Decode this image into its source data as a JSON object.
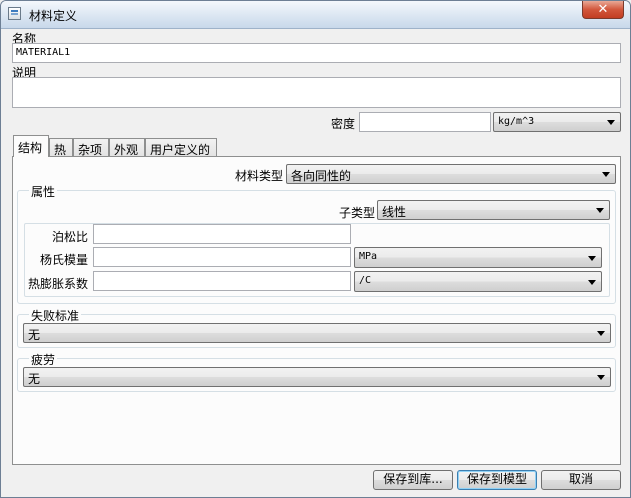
{
  "window": {
    "title": "材料定义",
    "close_glyph": "✕",
    "icon": "app-form-icon"
  },
  "name_label": "名称",
  "name_value": "MATERIAL1",
  "description_label": "说明",
  "description_value": "",
  "density": {
    "label": "密度",
    "value": "",
    "unit": "kg/m^3"
  },
  "tabs": [
    {
      "label": "结构",
      "active": true
    },
    {
      "label": "热"
    },
    {
      "label": "杂项"
    },
    {
      "label": "外观"
    },
    {
      "label": "用户定义的"
    }
  ],
  "material_type": {
    "label": "材料类型",
    "value": "各向同性的"
  },
  "properties": {
    "title": "属性",
    "subtype_label": "子类型",
    "subtype_value": "线性",
    "rows": [
      {
        "label": "泊松比",
        "value": ""
      },
      {
        "label": "杨氏模量",
        "value": "",
        "unit": "MPa"
      },
      {
        "label": "热膨胀系数",
        "value": "",
        "unit": "/C"
      }
    ]
  },
  "failure_criteria": {
    "title": "失败标准",
    "value": "无"
  },
  "fatigue": {
    "title": "疲劳",
    "value": "无"
  },
  "buttons": {
    "save_to_library": "保存到库...",
    "save_to_model": "保存到模型",
    "cancel": "取消"
  },
  "colors": {
    "titlebar": "#dbe6f2",
    "close_button": "#c8452a",
    "panel_background": "#fcfcfc",
    "window_background": "#f0f0f0"
  }
}
